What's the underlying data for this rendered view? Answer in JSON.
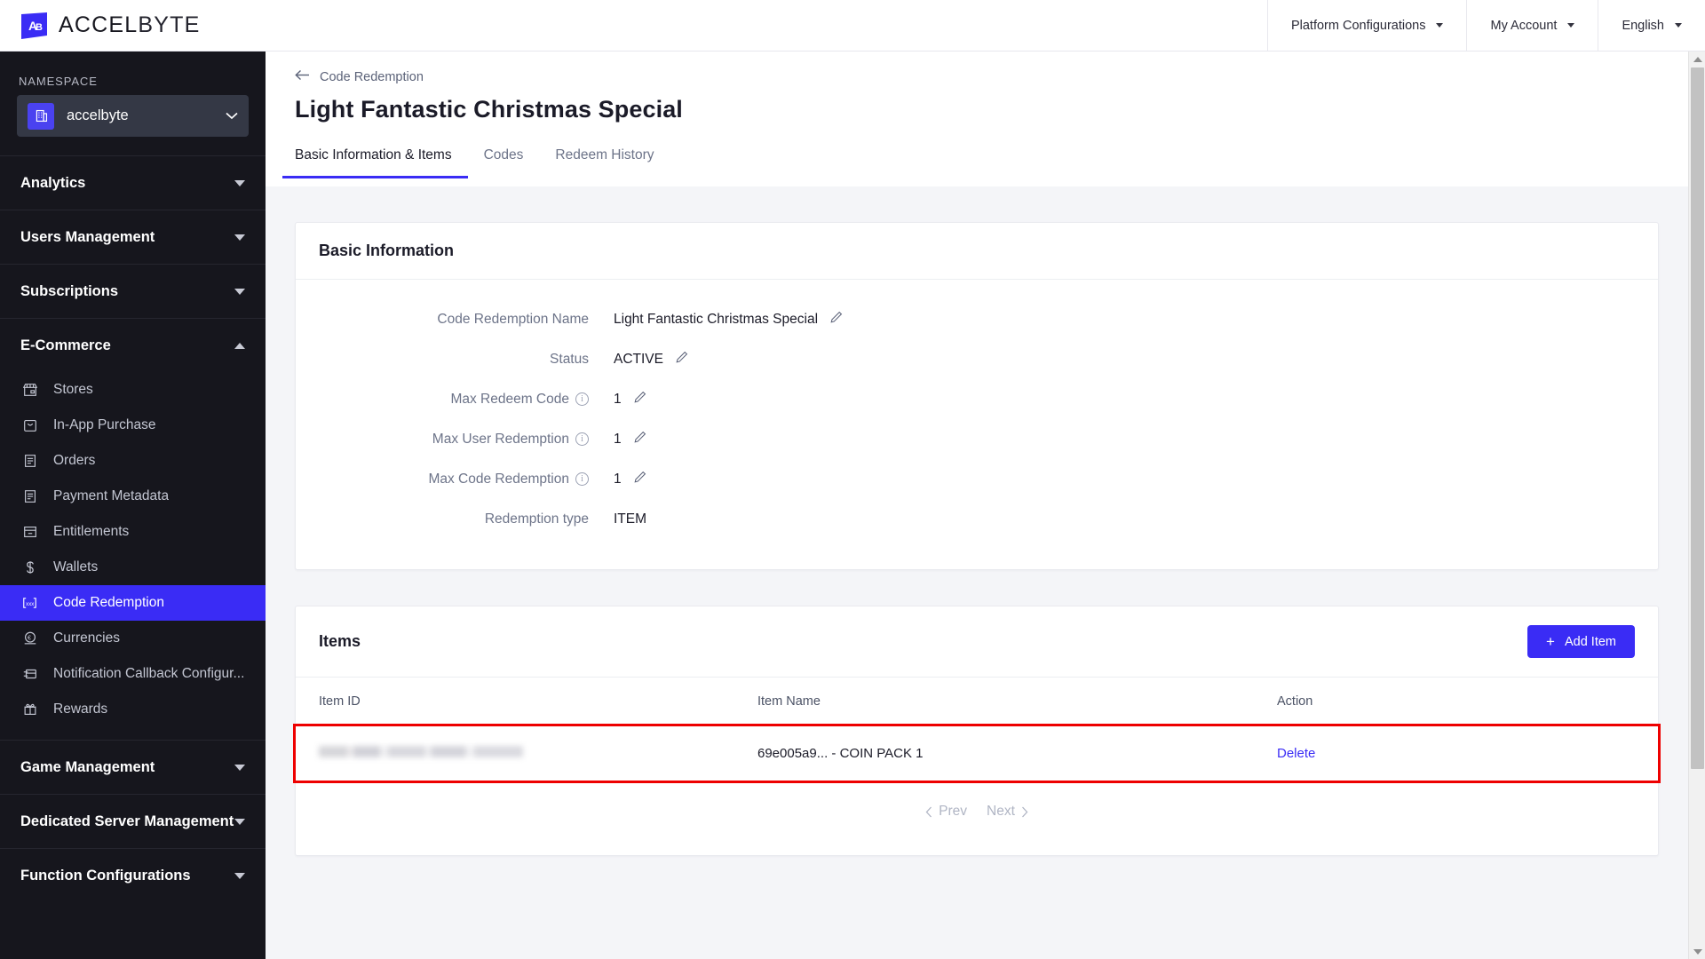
{
  "brand": {
    "name_a": "ACCEL",
    "name_b": "BYTE",
    "logo_icon": "accelbyte-logo-icon",
    "accent": "#3a2cf5"
  },
  "topbar": {
    "menus": [
      {
        "label": "Platform Configurations",
        "icon": "chevron-down-icon"
      },
      {
        "label": "My Account",
        "icon": "chevron-down-icon"
      },
      {
        "label": "English",
        "icon": "chevron-down-icon"
      }
    ]
  },
  "sidebar": {
    "namespace_label": "NAMESPACE",
    "namespace_value": "accelbyte",
    "namespace_icon": "building-icon",
    "namespace_caret": "chevron-down-icon",
    "groups": [
      {
        "label": "Analytics",
        "caret": "caret-down-icon",
        "expanded": false,
        "items": []
      },
      {
        "label": "Users Management",
        "caret": "caret-down-icon",
        "expanded": false,
        "items": []
      },
      {
        "label": "Subscriptions",
        "caret": "caret-down-icon",
        "expanded": false,
        "items": []
      },
      {
        "label": "E-Commerce",
        "caret": "caret-up-icon",
        "expanded": true,
        "items": [
          {
            "label": "Stores",
            "icon": "store-icon",
            "active": false
          },
          {
            "label": "In-App Purchase",
            "icon": "bag-icon",
            "active": false
          },
          {
            "label": "Orders",
            "icon": "receipt-list-icon",
            "active": false
          },
          {
            "label": "Payment Metadata",
            "icon": "document-icon",
            "active": false
          },
          {
            "label": "Entitlements",
            "icon": "drawer-icon",
            "active": false
          },
          {
            "label": "Wallets",
            "icon": "dollar-icon",
            "active": false
          },
          {
            "label": "Code Redemption",
            "icon": "code-brackets-icon",
            "active": true
          },
          {
            "label": "Currencies",
            "icon": "euro-coin-icon",
            "active": false
          },
          {
            "label": "Notification Callback Configur...",
            "icon": "card-swipe-icon",
            "active": false
          },
          {
            "label": "Rewards",
            "icon": "gift-icon",
            "active": false
          }
        ]
      },
      {
        "label": "Game Management",
        "caret": "caret-down-icon",
        "expanded": false,
        "items": []
      },
      {
        "label": "Dedicated Server Management",
        "caret": "caret-down-icon",
        "expanded": false,
        "items": []
      },
      {
        "label": "Function Configurations",
        "caret": "caret-down-icon",
        "expanded": false,
        "items": []
      }
    ]
  },
  "page": {
    "breadcrumb": "Code Redemption",
    "back_icon": "arrow-left-icon",
    "title": "Light Fantastic Christmas Special",
    "tabs": [
      {
        "label": "Basic Information & Items",
        "active": true
      },
      {
        "label": "Codes",
        "active": false
      },
      {
        "label": "Redeem History",
        "active": false
      }
    ]
  },
  "basic_information": {
    "title": "Basic Information",
    "fields": [
      {
        "label": "Code Redemption Name",
        "value": "Light Fantastic Christmas Special",
        "has_info": false,
        "has_edit": true,
        "edit_icon": "pencil-icon"
      },
      {
        "label": "Status",
        "value": "ACTIVE",
        "has_info": false,
        "has_edit": true,
        "edit_icon": "pencil-icon"
      },
      {
        "label": "Max Redeem Code",
        "value": "1",
        "has_info": true,
        "info_icon": "info-circle-icon",
        "has_edit": true,
        "edit_icon": "pencil-icon"
      },
      {
        "label": "Max User Redemption",
        "value": "1",
        "has_info": true,
        "info_icon": "info-circle-icon",
        "has_edit": true,
        "edit_icon": "pencil-icon"
      },
      {
        "label": "Max Code Redemption",
        "value": "1",
        "has_info": true,
        "info_icon": "info-circle-icon",
        "has_edit": true,
        "edit_icon": "pencil-icon"
      },
      {
        "label": "Redemption type",
        "value": "ITEM",
        "has_info": false,
        "has_edit": false
      }
    ]
  },
  "items_section": {
    "title": "Items",
    "add_button": {
      "label": "Add Item",
      "icon": "plus-icon"
    },
    "columns": [
      "Item ID",
      "Item Name",
      "Action"
    ],
    "rows": [
      {
        "item_id": "",
        "item_id_redacted": true,
        "item_name": "69e005a9... - COIN PACK 1",
        "action_label": "Delete",
        "highlighted": true
      }
    ],
    "pagination": {
      "prev_label": "Prev",
      "next_label": "Next",
      "prev_icon": "chevron-left-icon",
      "next_icon": "chevron-right-icon"
    }
  },
  "scrollbar": {
    "up_icon": "arrow-up-icon",
    "down_icon": "arrow-down-icon"
  }
}
